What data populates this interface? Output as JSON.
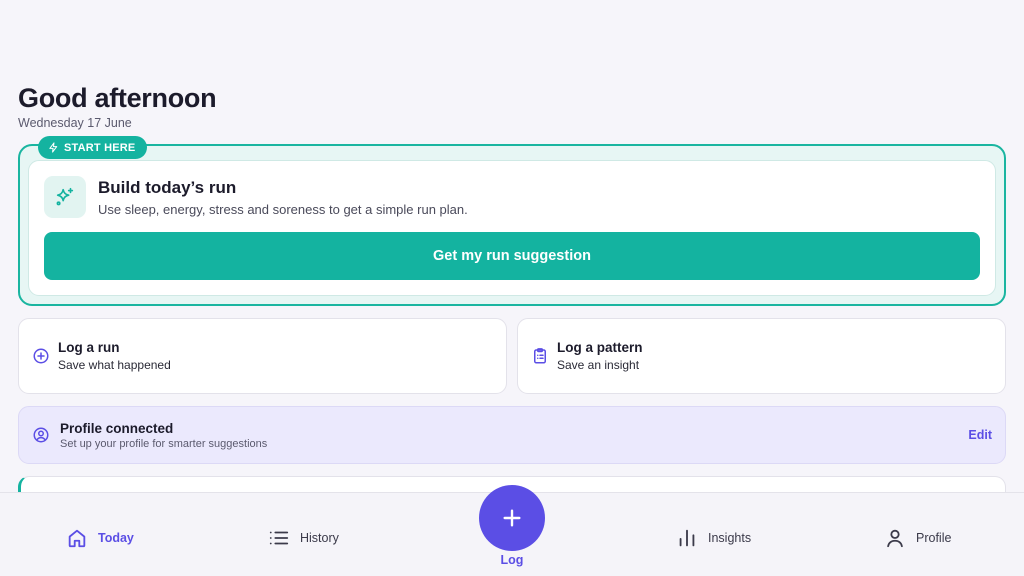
{
  "header": {
    "greeting": "Good afternoon",
    "date": "Wednesday 17 June"
  },
  "start_card": {
    "badge": "START HERE",
    "badge_icon": "zap-icon",
    "icon": "sparkles-icon",
    "title": "Build today’s run",
    "subtitle": "Use sleep, energy, stress and soreness to get a simple run plan.",
    "cta_label": "Get my run suggestion"
  },
  "quick_actions": [
    {
      "icon": "plus-circle-icon",
      "title": "Log a run",
      "subtitle": "Save what happened"
    },
    {
      "icon": "clipboard-list-icon",
      "title": "Log a pattern",
      "subtitle": "Save an insight"
    }
  ],
  "profile_banner": {
    "icon": "user-circle-icon",
    "title": "Profile connected",
    "subtitle": "Set up your profile for smarter suggestions",
    "action": "Edit"
  },
  "bottom_nav": {
    "items": [
      {
        "label": "Today",
        "icon": "home-icon",
        "active": true
      },
      {
        "label": "History",
        "icon": "list-icon",
        "active": false
      },
      {
        "label": "Log",
        "icon": "plus-icon",
        "active": false
      },
      {
        "label": "Insights",
        "icon": "bar-chart-icon",
        "active": false
      },
      {
        "label": "Profile",
        "icon": "user-icon",
        "active": false
      }
    ]
  },
  "colors": {
    "accent_teal": "#14b3a0",
    "accent_purple": "#5b4ee5",
    "background": "#f6f5fa"
  }
}
